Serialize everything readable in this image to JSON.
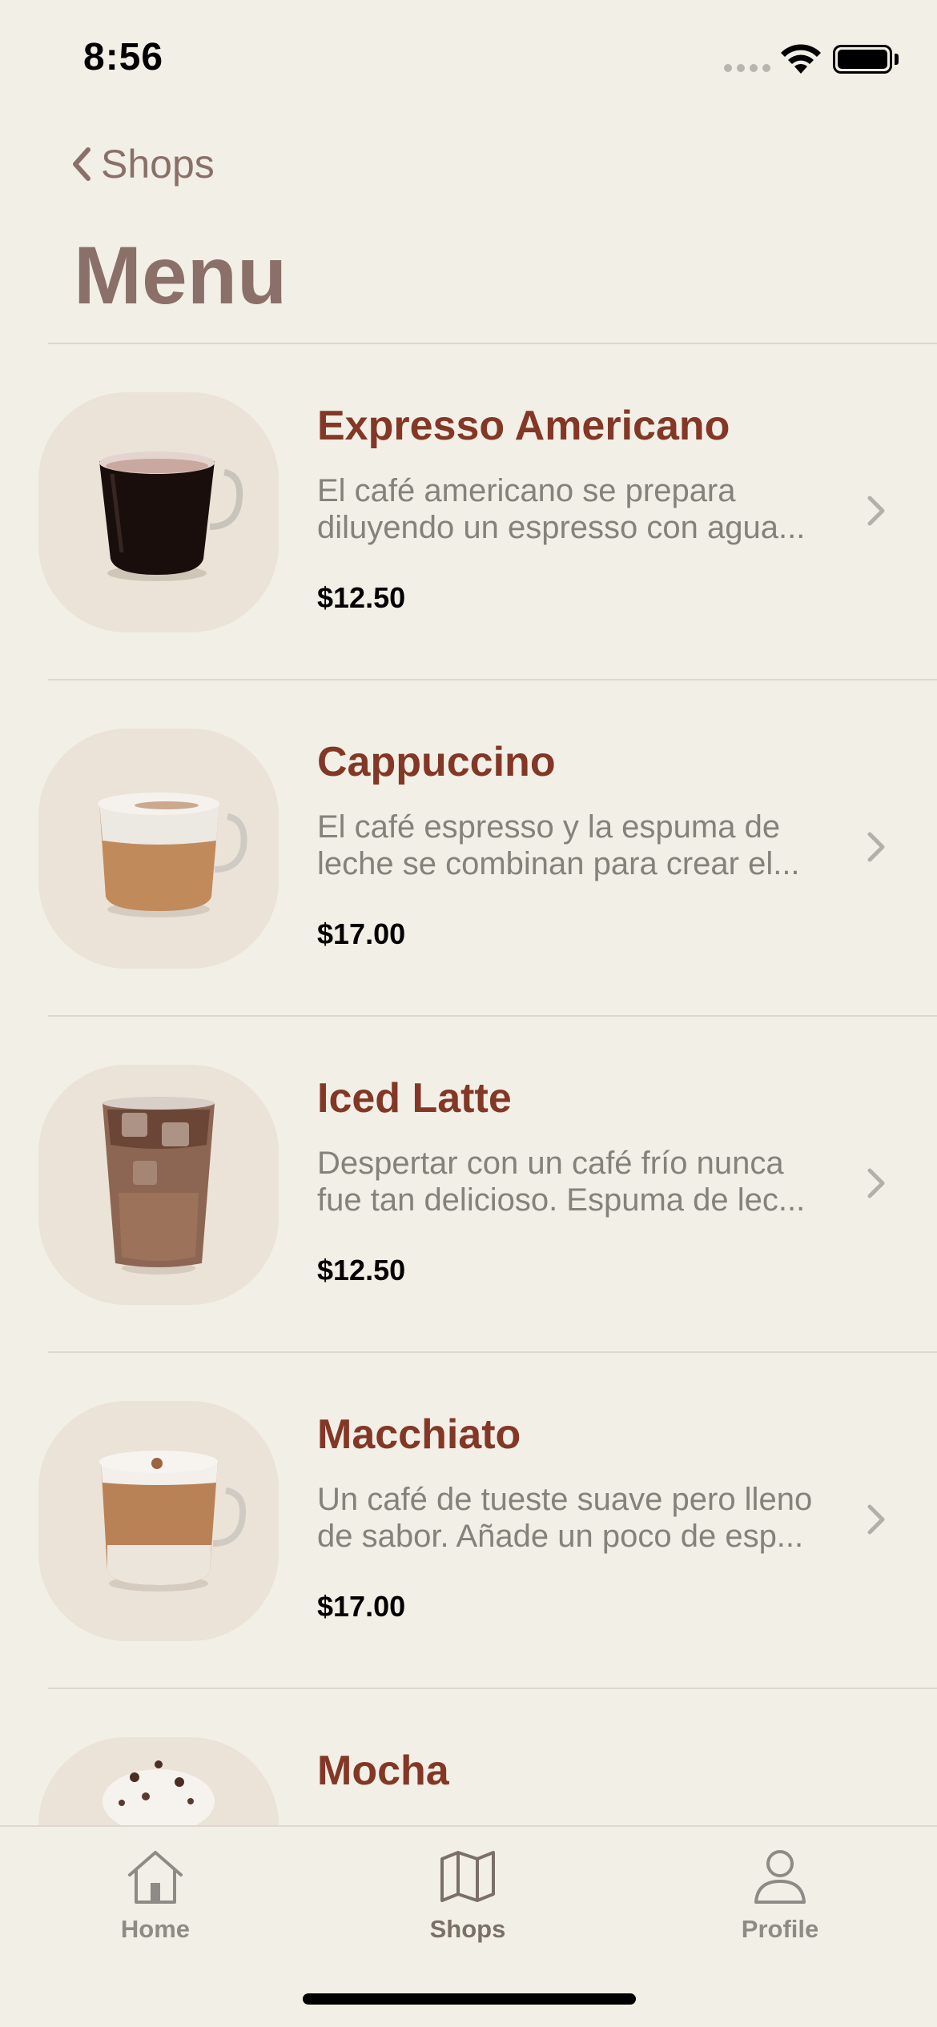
{
  "status_bar": {
    "time": "8:56"
  },
  "nav": {
    "back_label": "Shops",
    "title": "Menu"
  },
  "menu": [
    {
      "name": "Expresso Americano",
      "description": "El café americano se prepara diluyendo un espresso con agua...",
      "price": "$12.50",
      "drink": "americano"
    },
    {
      "name": "Cappuccino",
      "description": "El café espresso y la espuma de leche se combinan para crear el...",
      "price": "$17.00",
      "drink": "cappuccino"
    },
    {
      "name": "Iced Latte",
      "description": "Despertar con un café frío nunca fue tan delicioso. Espuma de lec...",
      "price": "$12.50",
      "drink": "iced-latte"
    },
    {
      "name": "Macchiato",
      "description": "Un café de tueste suave pero lleno de sabor. Añade un poco de esp...",
      "price": "$17.00",
      "drink": "macchiato"
    },
    {
      "name": "Mocha",
      "description": "",
      "price": "",
      "drink": "mocha"
    }
  ],
  "tab_bar": {
    "tabs": [
      {
        "label": "Home",
        "icon": "house-icon"
      },
      {
        "label": "Shops",
        "icon": "map-icon",
        "active": true
      },
      {
        "label": "Profile",
        "icon": "person-icon"
      }
    ]
  },
  "colors": {
    "background": "#f2efe6",
    "title": "#8a7068",
    "item_name": "#833726",
    "thumb_bg": "#ebe3d7"
  }
}
